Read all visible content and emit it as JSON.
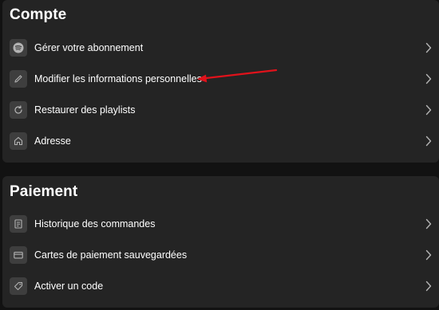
{
  "compte": {
    "title": "Compte",
    "items": [
      {
        "label": "Gérer votre abonnement",
        "icon": "spotify-icon"
      },
      {
        "label": "Modifier les informations personnelles",
        "icon": "pencil-icon"
      },
      {
        "label": "Restaurer des playlists",
        "icon": "refresh-icon"
      },
      {
        "label": "Adresse",
        "icon": "home-icon"
      }
    ]
  },
  "paiement": {
    "title": "Paiement",
    "items": [
      {
        "label": "Historique des commandes",
        "icon": "receipt-icon"
      },
      {
        "label": "Cartes de paiement sauvegardées",
        "icon": "credit-card-icon"
      },
      {
        "label": "Activer un code",
        "icon": "tag-icon"
      }
    ]
  },
  "colors": {
    "background": "#121212",
    "card": "#242424",
    "icon_box": "#3e3e3e",
    "annotation_arrow": "#e0121b"
  }
}
